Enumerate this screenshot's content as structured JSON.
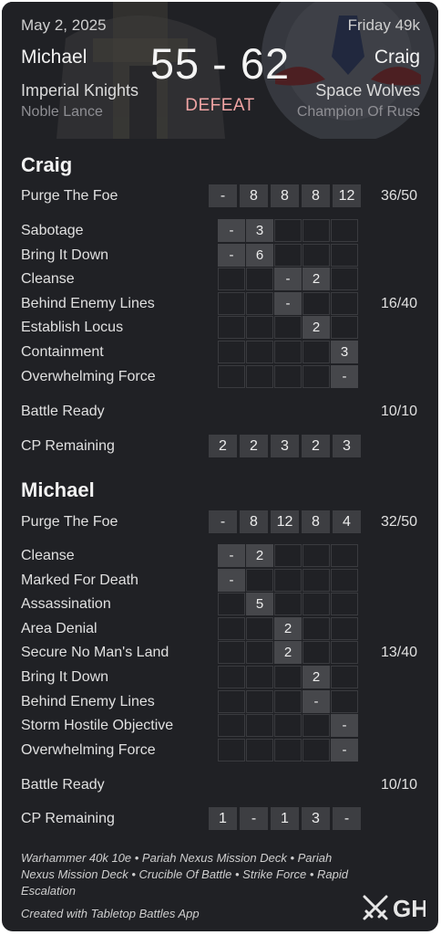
{
  "header": {
    "date": "May 2, 2025",
    "week": "Friday 49k",
    "score": "55 - 62",
    "result": "DEFEAT",
    "player_left": {
      "name": "Michael",
      "faction": "Imperial Knights",
      "detachment": "Noble Lance"
    },
    "player_right": {
      "name": "Craig",
      "faction": "Space Wolves",
      "detachment": "Champion Of Russ"
    }
  },
  "sections": [
    {
      "name": "Craig",
      "primary": {
        "label": "Purge The Foe",
        "rounds": [
          "-",
          "8",
          "8",
          "8",
          "12"
        ],
        "total": "36/50"
      },
      "secondaries_total": "16/40",
      "secondaries": [
        {
          "label": "Sabotage",
          "rounds": [
            "-",
            "3",
            "",
            "",
            ""
          ],
          "active": [
            1,
            1,
            0,
            0,
            0
          ]
        },
        {
          "label": "Bring It Down",
          "rounds": [
            "-",
            "6",
            "",
            "",
            ""
          ],
          "active": [
            1,
            1,
            0,
            0,
            0
          ]
        },
        {
          "label": "Cleanse",
          "rounds": [
            "",
            "",
            "-",
            "2",
            ""
          ],
          "active": [
            0,
            0,
            1,
            1,
            0
          ]
        },
        {
          "label": "Behind Enemy Lines",
          "rounds": [
            "",
            "",
            "-",
            "",
            ""
          ],
          "active": [
            0,
            0,
            1,
            0,
            0
          ]
        },
        {
          "label": "Establish Locus",
          "rounds": [
            "",
            "",
            "",
            "2",
            ""
          ],
          "active": [
            0,
            0,
            0,
            1,
            0
          ]
        },
        {
          "label": "Containment",
          "rounds": [
            "",
            "",
            "",
            "",
            "3"
          ],
          "active": [
            0,
            0,
            0,
            0,
            1
          ]
        },
        {
          "label": "Overwhelming Force",
          "rounds": [
            "",
            "",
            "",
            "",
            "-"
          ],
          "active": [
            0,
            0,
            0,
            0,
            1
          ]
        }
      ],
      "battle_ready": {
        "label": "Battle Ready",
        "total": "10/10"
      },
      "cp": {
        "label": "CP Remaining",
        "rounds": [
          "2",
          "2",
          "3",
          "2",
          "3"
        ]
      }
    },
    {
      "name": "Michael",
      "primary": {
        "label": "Purge The Foe",
        "rounds": [
          "-",
          "8",
          "12",
          "8",
          "4"
        ],
        "total": "32/50"
      },
      "secondaries_total": "13/40",
      "secondaries": [
        {
          "label": "Cleanse",
          "rounds": [
            "-",
            "2",
            "",
            "",
            ""
          ],
          "active": [
            1,
            1,
            0,
            0,
            0
          ]
        },
        {
          "label": "Marked For Death",
          "rounds": [
            "-",
            "",
            "",
            "",
            ""
          ],
          "active": [
            1,
            0,
            0,
            0,
            0
          ]
        },
        {
          "label": "Assassination",
          "rounds": [
            "",
            "5",
            "",
            "",
            ""
          ],
          "active": [
            0,
            1,
            0,
            0,
            0
          ]
        },
        {
          "label": "Area Denial",
          "rounds": [
            "",
            "",
            "2",
            "",
            ""
          ],
          "active": [
            0,
            0,
            1,
            0,
            0
          ]
        },
        {
          "label": "Secure No Man's Land",
          "rounds": [
            "",
            "",
            "2",
            "",
            ""
          ],
          "active": [
            0,
            0,
            1,
            0,
            0
          ]
        },
        {
          "label": "Bring It Down",
          "rounds": [
            "",
            "",
            "",
            "2",
            ""
          ],
          "active": [
            0,
            0,
            0,
            1,
            0
          ]
        },
        {
          "label": "Behind Enemy Lines",
          "rounds": [
            "",
            "",
            "",
            "-",
            ""
          ],
          "active": [
            0,
            0,
            0,
            1,
            0
          ]
        },
        {
          "label": "Storm Hostile Objective",
          "rounds": [
            "",
            "",
            "",
            "",
            "-"
          ],
          "active": [
            0,
            0,
            0,
            0,
            1
          ]
        },
        {
          "label": "Overwhelming Force",
          "rounds": [
            "",
            "",
            "",
            "",
            "-"
          ],
          "active": [
            0,
            0,
            0,
            0,
            1
          ]
        }
      ],
      "battle_ready": {
        "label": "Battle Ready",
        "total": "10/10"
      },
      "cp": {
        "label": "CP Remaining",
        "rounds": [
          "1",
          "-",
          "1",
          "3",
          "-"
        ]
      }
    }
  ],
  "footer": {
    "mission": "Warhammer 40k 10e • Pariah Nexus Mission Deck • Pariah Nexus Mission Deck • Crucible Of Battle • Strike Force • Rapid Escalation",
    "credit": "Created with Tabletop Battles App",
    "logo_text": "GH"
  },
  "colors": {
    "background": "#202125",
    "cell_active": "#46474b",
    "defeat": "#f0a4a4",
    "muted": "#8e8e93"
  }
}
